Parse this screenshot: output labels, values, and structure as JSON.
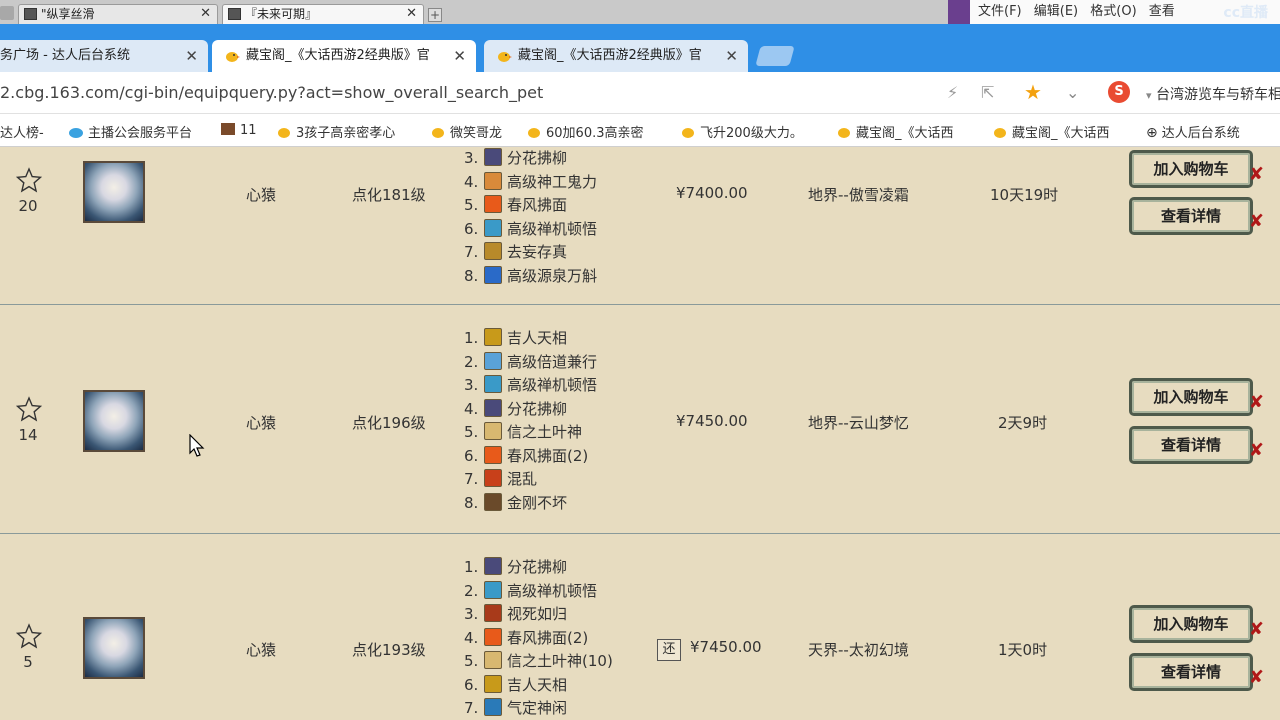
{
  "os_bar": {
    "tabs": [
      {
        "label": "\"纵享丝滑"
      },
      {
        "label": "『未来可期』"
      }
    ],
    "notepad_menu": [
      "文件(F)",
      "编辑(E)",
      "格式(O)",
      "查看"
    ],
    "watermark": "cc直播"
  },
  "browser": {
    "tabs": [
      {
        "label": "务广场 - 达人后台系统",
        "active": false
      },
      {
        "label": "藏宝阁_《大话西游2经典版》官",
        "active": true
      },
      {
        "label": "藏宝阁_《大话西游2经典版》官",
        "active": false
      }
    ],
    "url": "2.cbg.163.com/cgi-bin/equipquery.py?act=show_overall_search_pet",
    "search_engine_text": "台湾游览车与轿车相",
    "bookmarks": [
      "达人榜-",
      "主播公会服务平台",
      "11",
      "3孩子高亲密孝心",
      "微笑哥龙",
      "60加60.3高亲密",
      "飞升200级大力。",
      "藏宝阁_《大话西",
      "藏宝阁_《大话西",
      "达人后台系统"
    ]
  },
  "listings": [
    {
      "fav_count": "20",
      "name": "心猿",
      "level": "点化181级",
      "skills": [
        {
          "num": "3.",
          "name": "分花拂柳"
        },
        {
          "num": "4.",
          "name": "高级神工鬼力"
        },
        {
          "num": "5.",
          "name": "春风拂面"
        },
        {
          "num": "6.",
          "name": "高级禅机顿悟"
        },
        {
          "num": "7.",
          "name": "去妄存真"
        },
        {
          "num": "8.",
          "name": "高级源泉万斛"
        }
      ],
      "price": "¥7400.00",
      "server": "地界--傲雪凌霜",
      "time_left": "10天19时",
      "add_cart": "加入购物车",
      "view_detail": "查看详情"
    },
    {
      "fav_count": "14",
      "name": "心猿",
      "level": "点化196级",
      "skills": [
        {
          "num": "1.",
          "name": "吉人天相"
        },
        {
          "num": "2.",
          "name": "高级倍道兼行"
        },
        {
          "num": "3.",
          "name": "高级禅机顿悟"
        },
        {
          "num": "4.",
          "name": "分花拂柳"
        },
        {
          "num": "5.",
          "name": "信之土叶神"
        },
        {
          "num": "6.",
          "name": "春风拂面(2)"
        },
        {
          "num": "7.",
          "name": "混乱"
        },
        {
          "num": "8.",
          "name": "金刚不坏"
        }
      ],
      "price": "¥7450.00",
      "server": "地界--云山梦忆",
      "time_left": "2天9时",
      "add_cart": "加入购物车",
      "view_detail": "查看详情"
    },
    {
      "fav_count": "5",
      "name": "心猿",
      "level": "点化193级",
      "skills": [
        {
          "num": "1.",
          "name": "分花拂柳"
        },
        {
          "num": "2.",
          "name": "高级禅机顿悟"
        },
        {
          "num": "3.",
          "name": "视死如归"
        },
        {
          "num": "4.",
          "name": "春风拂面(2)"
        },
        {
          "num": "5.",
          "name": "信之土叶神(10)"
        },
        {
          "num": "6.",
          "name": "吉人天相"
        },
        {
          "num": "7.",
          "name": "气定神闲"
        }
      ],
      "bargain_badge": "还",
      "price": "¥7450.00",
      "server": "天界--太初幻境",
      "time_left": "1天0时",
      "add_cart": "加入购物车",
      "view_detail": "查看详情"
    }
  ],
  "colors": {
    "tab_bar": "#2f8fe6",
    "content_bg": "#e7dcc0",
    "button_border": "#4e5a4b",
    "close_x": "#b01818"
  }
}
